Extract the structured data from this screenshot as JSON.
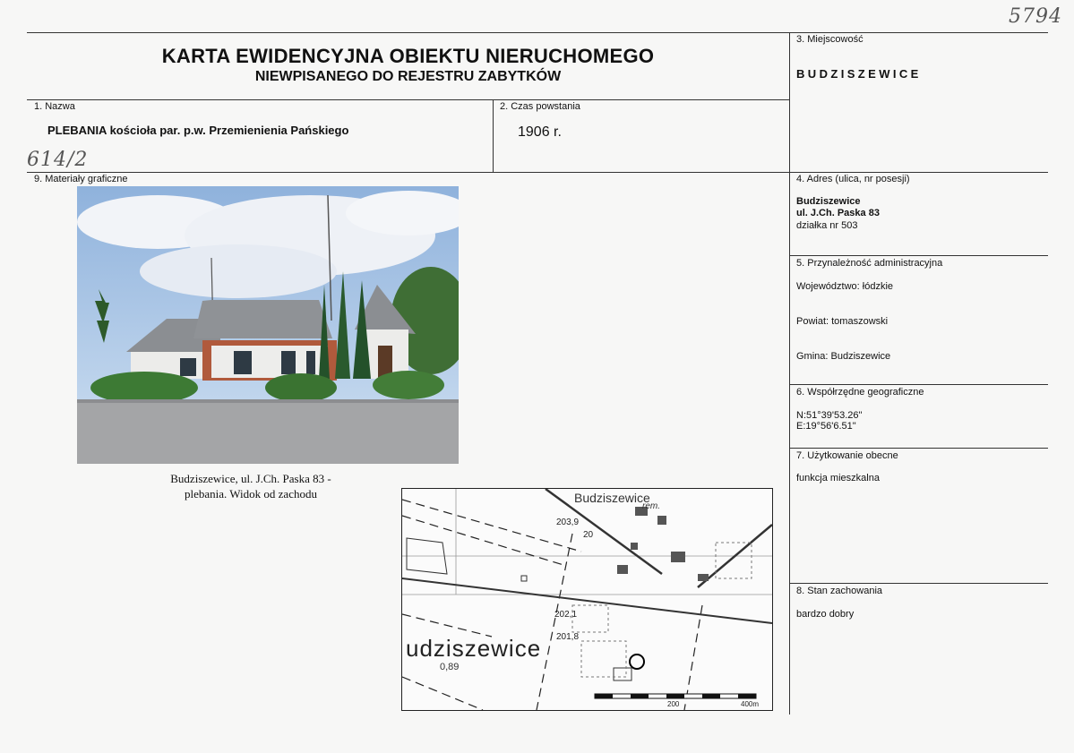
{
  "header": {
    "title_line1": "KARTA EWIDENCYJNA OBIEKTU NIERUCHOMEGO",
    "title_line2": "NIEWPISANEGO DO REJESTRU ZABYTKÓW"
  },
  "handwritten": {
    "number_top": "5794",
    "number_left": "614/2"
  },
  "field_1": {
    "label": "1. Nazwa",
    "value": "PLEBANIA kościoła par. p.w. Przemienienia Pańskiego"
  },
  "field_2": {
    "label": "2. Czas powstania",
    "value": "1906 r."
  },
  "field_3": {
    "label": "3. Miejscowość",
    "value": "BUDZISZEWICE"
  },
  "field_4": {
    "label": "4. Adres (ulica, nr posesji)",
    "line1": "Budziszewice",
    "line2": "ul. J.Ch. Paska 83",
    "line3": "działka nr 503"
  },
  "field_5": {
    "label": "5. Przynależność administracyjna",
    "wojewodztwo": "Województwo: łódzkie",
    "powiat": "Powiat: tomaszowski",
    "gmina": "Gmina: Budziszewice"
  },
  "field_6": {
    "label": "6. Współrzędne geograficzne",
    "lat": "N:51°39'53.26\"",
    "lon": "E:19°56'6.51\""
  },
  "field_7": {
    "label": "7. Użytkowanie obecne",
    "value": "funkcja mieszkalna"
  },
  "field_8": {
    "label": "8. Stan zachowania",
    "value": "bardzo dobry"
  },
  "field_9": {
    "label": "9. Materiały graficzne",
    "photo_caption_line1": "Budziszewice, ul. J.Ch. Paska 83 -",
    "photo_caption_line2": "plebania. Widok od zachodu"
  },
  "map": {
    "town_label_top": "Budziszewice",
    "town_label_main": "udziszewice",
    "rem_label": "rem.",
    "elev1": "203,9",
    "elev2": "20",
    "elev3": "202,1",
    "elev4": "201,8",
    "elev5": "0,89",
    "scale_200": "200",
    "scale_400": "400m"
  }
}
